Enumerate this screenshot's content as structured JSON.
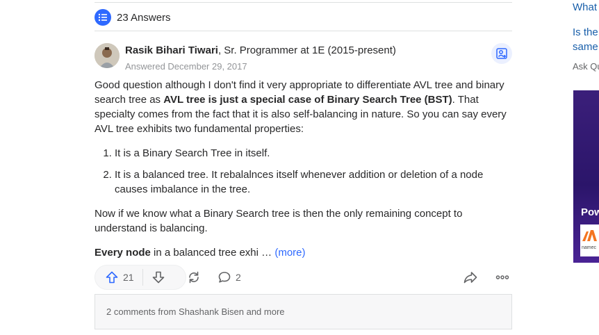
{
  "answers_header": {
    "label": "23 Answers",
    "icon": "list-icon",
    "accent": "#2e69ff"
  },
  "author": {
    "name": "Rasik Bihari Tiwari",
    "credential": ", Sr. Programmer at 1E (2015-present)",
    "answered": "Answered December 29, 2017"
  },
  "answer": {
    "p1_part1": "Good question although I don't find it very appropriate to differentiate AVL tree and binary search tree as ",
    "p1_bold": "AVL tree is just a special case of Binary Search Tree (BST)",
    "p1_part2": ". That specialty comes from the fact that it is also self-balancing in nature. So you can say every AVL tree exhibits two fundamental properties:",
    "list": [
      "It is a Binary Search Tree in itself.",
      "It is a balanced tree. It rebalalnces itself whenever addition or deletion of a node causes imbalance in the tree."
    ],
    "p2": "Now if we know what a Binary Search tree is then the only remaining concept to understand is balancing.",
    "p3_bold": "Every node",
    "p3_rest": " in a balanced tree exhi … ",
    "more": "(more)"
  },
  "actions": {
    "upvotes": "21",
    "comments": "2",
    "icons": [
      "upvote-icon",
      "downvote-icon",
      "share-icon",
      "comment-icon",
      "forward-icon",
      "more-icon"
    ]
  },
  "comments_preview": "2 comments from Shashank Bisen and more",
  "sidebar": {
    "related_line1": "What",
    "related_line2a": "Is the",
    "related_line2b": "same",
    "ask_question": "Ask Qu",
    "ad_text": "Pow",
    "ad_logo_word": "namec"
  }
}
